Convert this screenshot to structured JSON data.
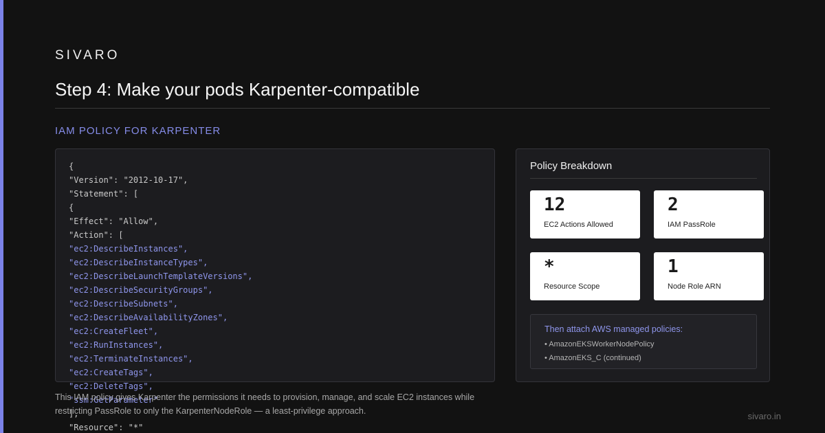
{
  "brand": "SIVARO",
  "title": "Step 4: Make your pods Karpenter-compatible",
  "section_label": "IAM POLICY FOR KARPENTER",
  "code": {
    "lines": [
      {
        "text": "{",
        "kind": "plain"
      },
      {
        "text": "\"Version\": \"2012-10-17\",",
        "kind": "plain"
      },
      {
        "text": "\"Statement\": [",
        "kind": "plain"
      },
      {
        "text": "{",
        "kind": "plain"
      },
      {
        "text": "\"Effect\": \"Allow\",",
        "kind": "plain"
      },
      {
        "text": "\"Action\": [",
        "kind": "plain"
      },
      {
        "text": "\"ec2:DescribeInstances\",",
        "kind": "str"
      },
      {
        "text": "\"ec2:DescribeInstanceTypes\",",
        "kind": "str"
      },
      {
        "text": "\"ec2:DescribeLaunchTemplateVersions\",",
        "kind": "str"
      },
      {
        "text": "\"ec2:DescribeSecurityGroups\",",
        "kind": "str"
      },
      {
        "text": "\"ec2:DescribeSubnets\",",
        "kind": "str"
      },
      {
        "text": "\"ec2:DescribeAvailabilityZones\",",
        "kind": "str"
      },
      {
        "text": "\"ec2:CreateFleet\",",
        "kind": "str"
      },
      {
        "text": "\"ec2:RunInstances\",",
        "kind": "str"
      },
      {
        "text": "\"ec2:TerminateInstances\",",
        "kind": "str"
      },
      {
        "text": "\"ec2:CreateTags\",",
        "kind": "str"
      },
      {
        "text": "\"ec2:DeleteTags\",",
        "kind": "str"
      },
      {
        "text": "\"ssm:GetParameter\"",
        "kind": "str"
      },
      {
        "text": "],",
        "kind": "plain"
      },
      {
        "text": "\"Resource\": \"*\"",
        "kind": "plain"
      }
    ]
  },
  "description": "This IAM policy gives Karpenter the permissions it needs to provision, manage, and scale EC2 instances while restricting PassRole to only the KarpenterNodeRole — a least-privilege approach.",
  "footer_link": "sivaro.in",
  "breakdown": {
    "title": "Policy Breakdown",
    "stats": [
      {
        "value": "12",
        "label": "EC2 Actions Allowed"
      },
      {
        "value": "2",
        "label": "IAM PassRole"
      },
      {
        "value": "*",
        "label": "Resource Scope"
      },
      {
        "value": "1",
        "label": "Node Role ARN"
      }
    ],
    "attach": {
      "title": "Then attach AWS managed policies:",
      "items": [
        "• AmazonEKSWorkerNodePolicy",
        "• AmazonEKS_C (continued)"
      ]
    }
  },
  "colors": {
    "accent": "#7b82e8",
    "background": "#121212",
    "panel": "#1c1c1f",
    "code_string": "#8f96ec"
  }
}
